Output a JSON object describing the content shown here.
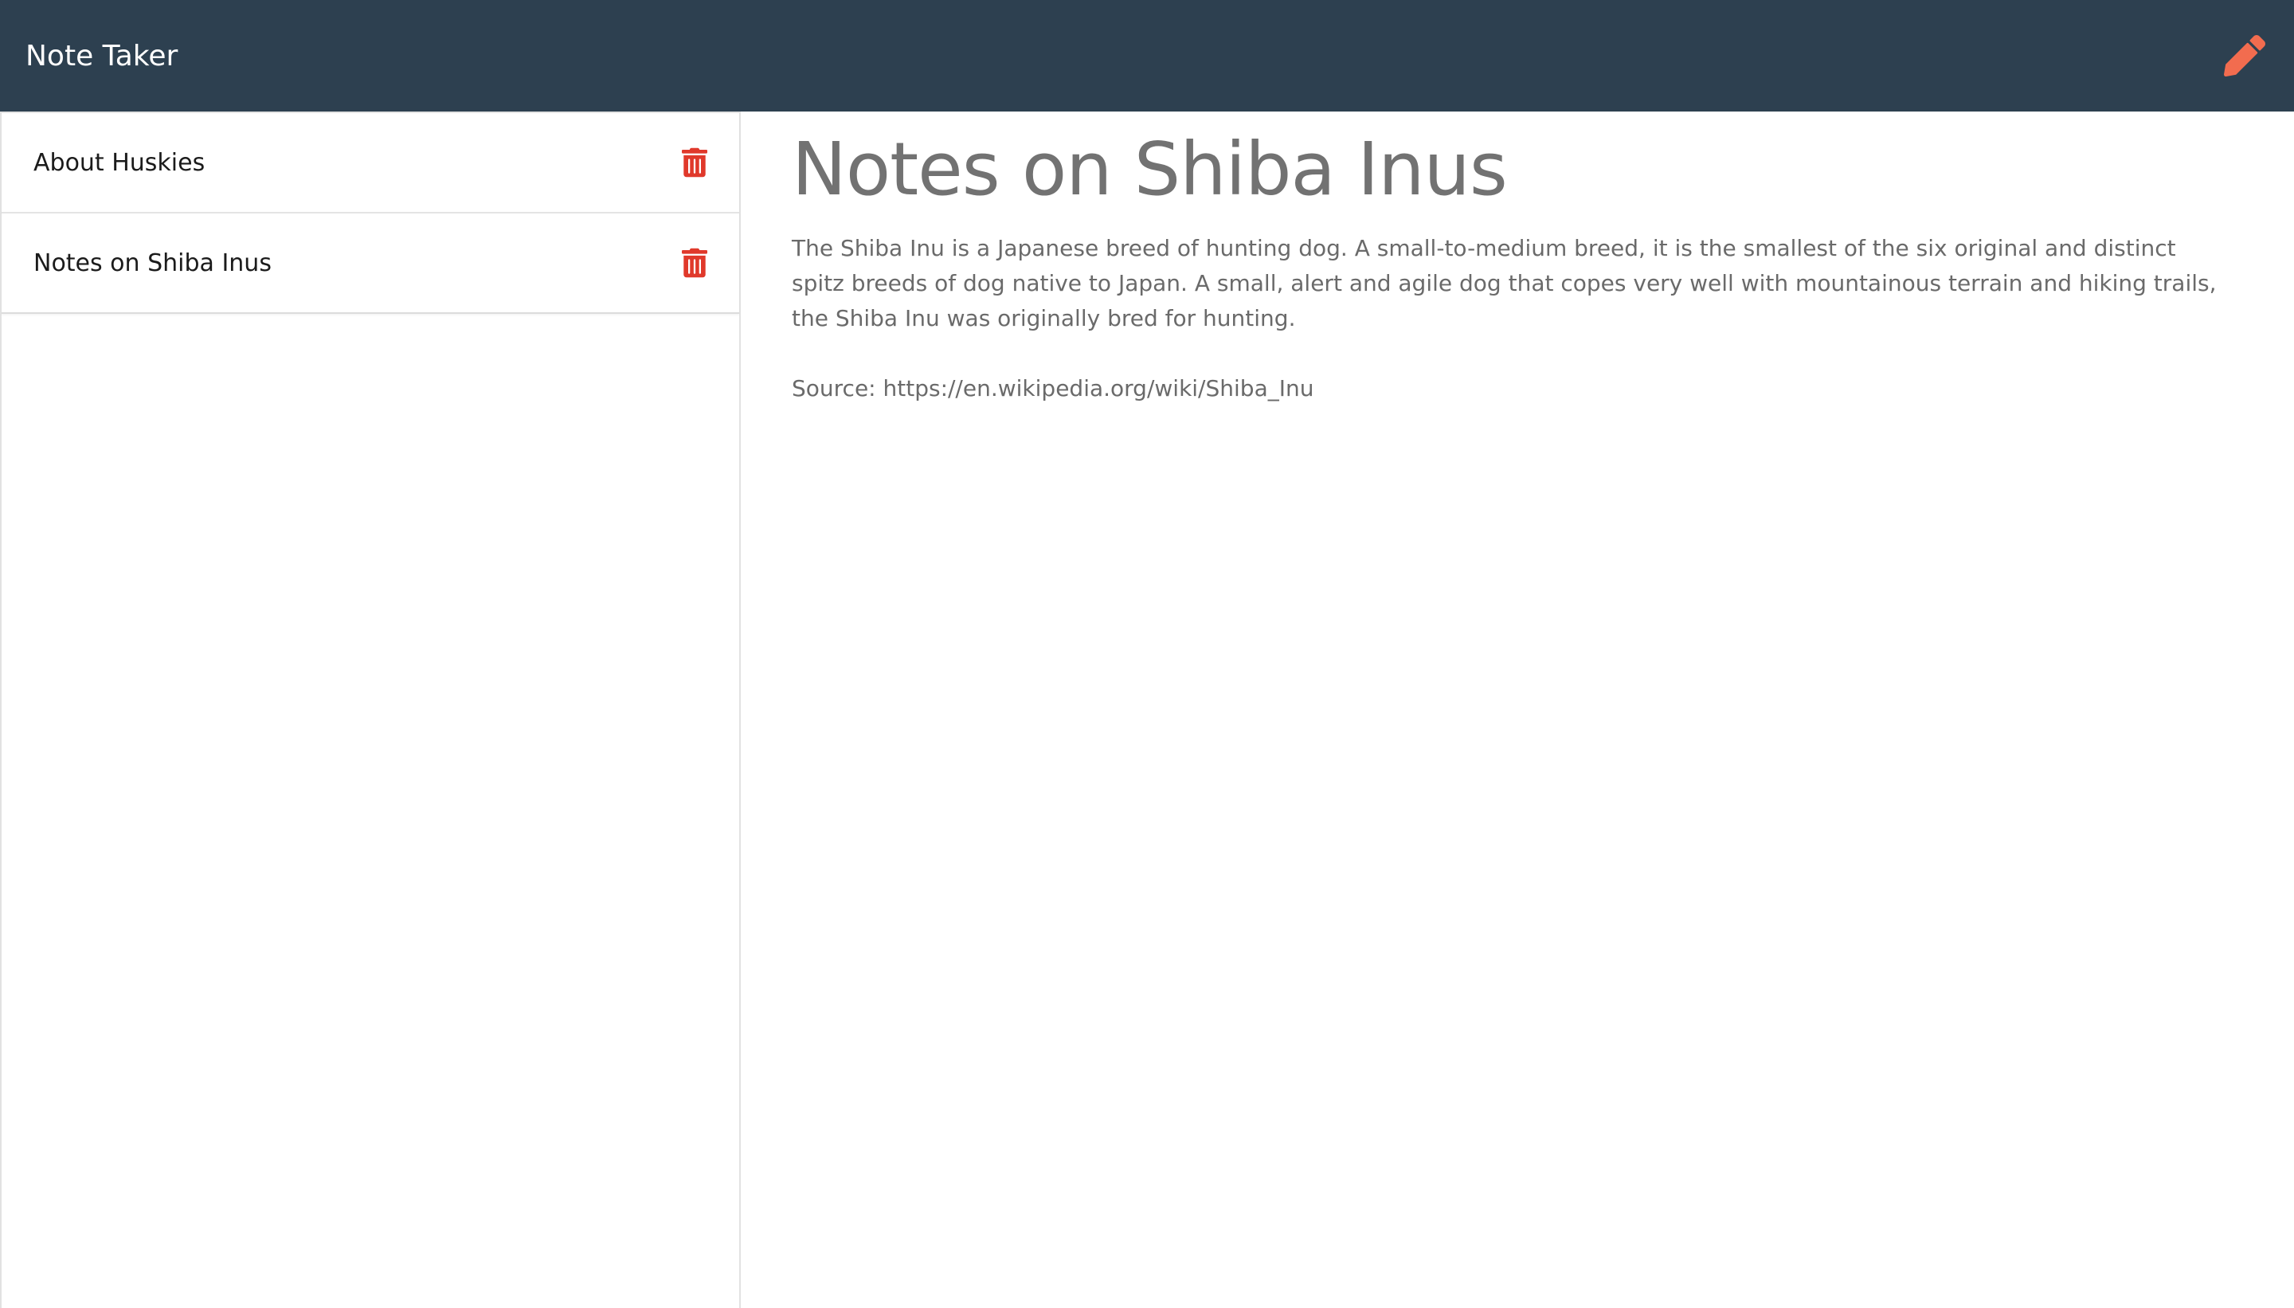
{
  "app": {
    "title": "Note Taker",
    "new_note_icon": "pencil-icon",
    "colors": {
      "navbar": "#2d4050",
      "accent": "#f26c4f",
      "delete": "#e0392b"
    }
  },
  "sidebar": {
    "notes": [
      {
        "title": "About Huskies",
        "delete_icon": "trash-icon"
      },
      {
        "title": "Notes on Shiba Inus",
        "delete_icon": "trash-icon"
      }
    ]
  },
  "main": {
    "note_title": "Notes on Shiba Inus",
    "note_text": "The Shiba Inu is a Japanese breed of hunting dog. A small-to-medium breed, it is the smallest of the six original and distinct spitz breeds of dog native to Japan. A small, alert and agile dog that copes very well with mountainous terrain and hiking trails, the Shiba Inu was originally bred for hunting.",
    "note_source": "Source: https://en.wikipedia.org/wiki/Shiba_Inu"
  }
}
